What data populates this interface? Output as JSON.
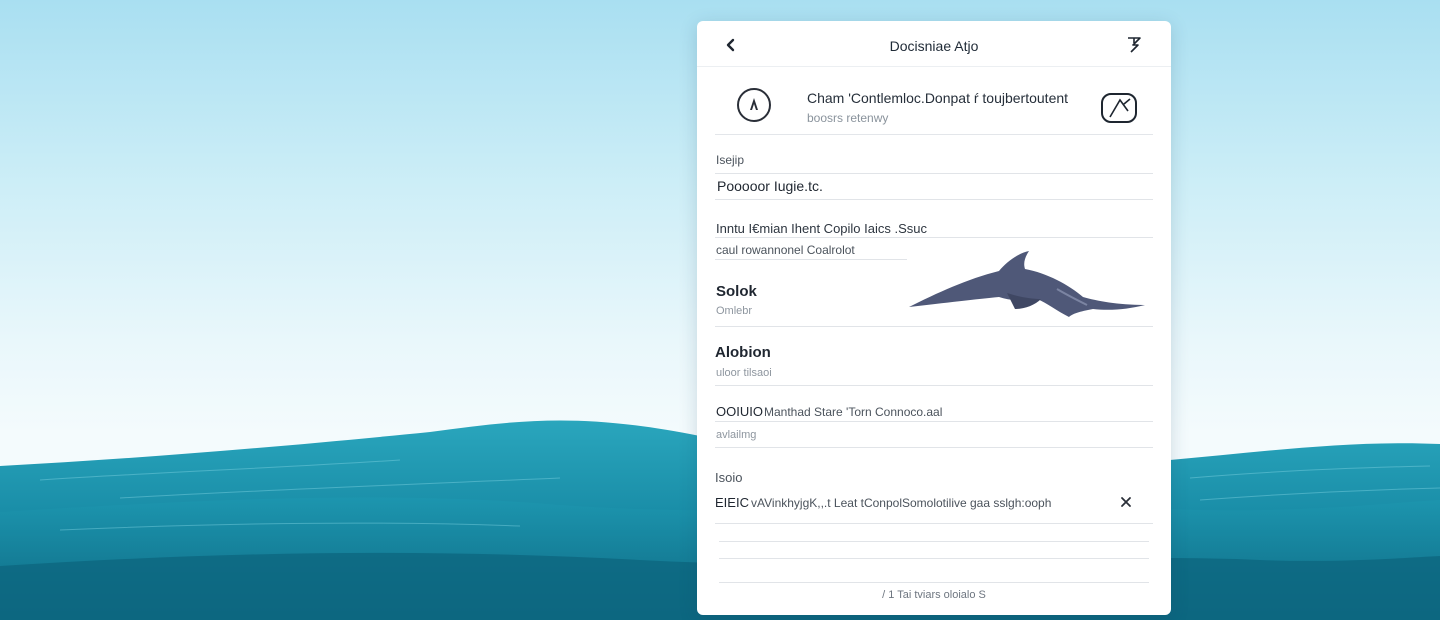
{
  "colors": {
    "sky_top": "#a9dff1",
    "sea_light": "#2aa6bd",
    "sea_dark": "#0f6e86",
    "dolphin": "#4f5878",
    "panel_bg": "#ffffff"
  },
  "topbar": {
    "back_icon": "chevron-left-icon",
    "title": "Docisniae Atjo",
    "share_icon": "share-icon"
  },
  "header": {
    "avatar_icon": "user-avatar-icon",
    "title": "Cham 'Contlemloc.Donpat ŕ toujbertoutent",
    "subtitle": "boosrs retenwy",
    "action_icon": "image-frame-icon"
  },
  "fields": [
    {
      "label": "Isejip",
      "value": "Pooooor Iugie.tc."
    },
    {
      "label": "Inntu I€mian Ihent Copilo Iaics .Ssuc",
      "value": "caul rowannonel Coalrolot"
    },
    {
      "label": "Solok",
      "value": "Omlebr"
    },
    {
      "label": "Alobion",
      "value": "uloor tilsaoi"
    },
    {
      "label": "OOIUIO",
      "value": "Manthad Stare 'Torn Connoco.aal",
      "sub": "avlailmg"
    },
    {
      "label": "Isoio",
      "value_prefix": "EIEIC",
      "value": "vAVinkhyjgK,,.t Leat tConpolSomolotilive gaa sslgh:ooph",
      "clear_icon": "close-icon"
    }
  ],
  "footer": {
    "text": "/ 1 Tai tviars oloialo S"
  }
}
